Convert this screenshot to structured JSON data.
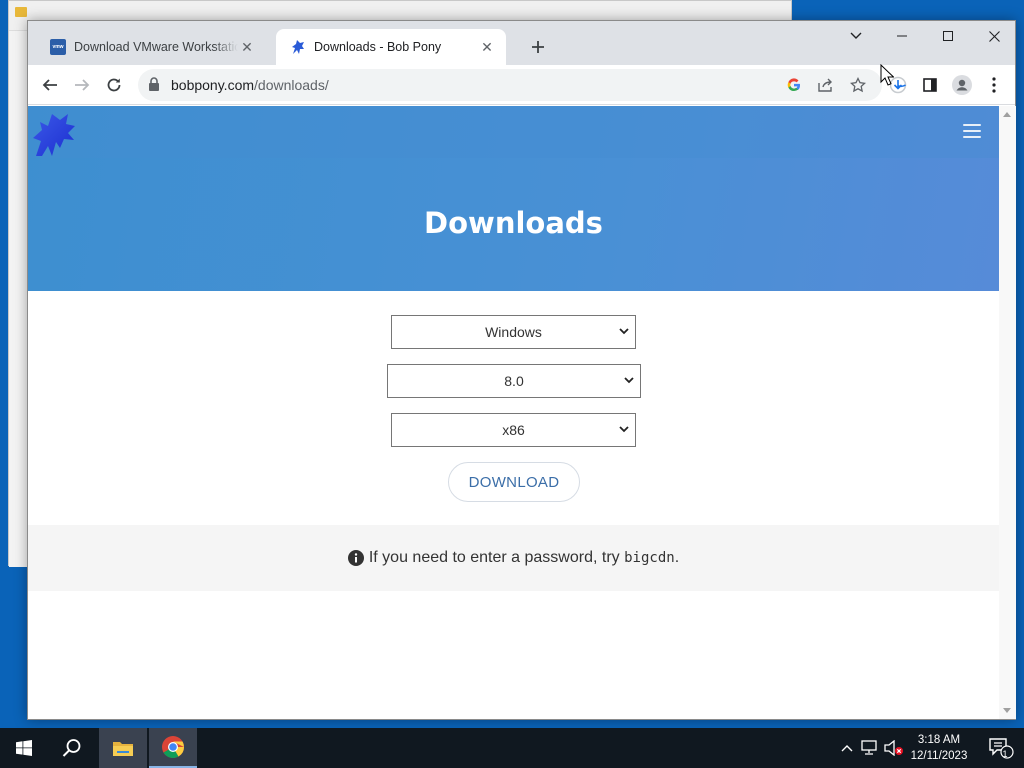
{
  "browser": {
    "tabs": [
      {
        "title": "Download VMware Workstation",
        "favicon": "vmware-icon",
        "favicon_text": "vmw",
        "active": false
      },
      {
        "title": "Downloads - Bob Pony",
        "favicon": "bobpony-icon",
        "active": true
      }
    ],
    "address": {
      "host": "bobpony.com",
      "path": "/downloads/"
    }
  },
  "page": {
    "heading": "Downloads",
    "os_select": "Windows",
    "version_select": "8.0",
    "arch_select": "x86",
    "download_button": "DOWNLOAD",
    "info_prefix": "If you need to enter a password, try",
    "info_password": "bigcdn",
    "info_suffix": "."
  },
  "taskbar": {
    "time": "3:18 AM",
    "date": "12/11/2023",
    "notification_count": "1"
  },
  "colors": {
    "hero_gradient_start": "#3d8fd0",
    "hero_gradient_end": "#568bd8",
    "download_text": "#3b6ea8",
    "taskbar": "#101820",
    "desktop": "#0a63b8"
  }
}
